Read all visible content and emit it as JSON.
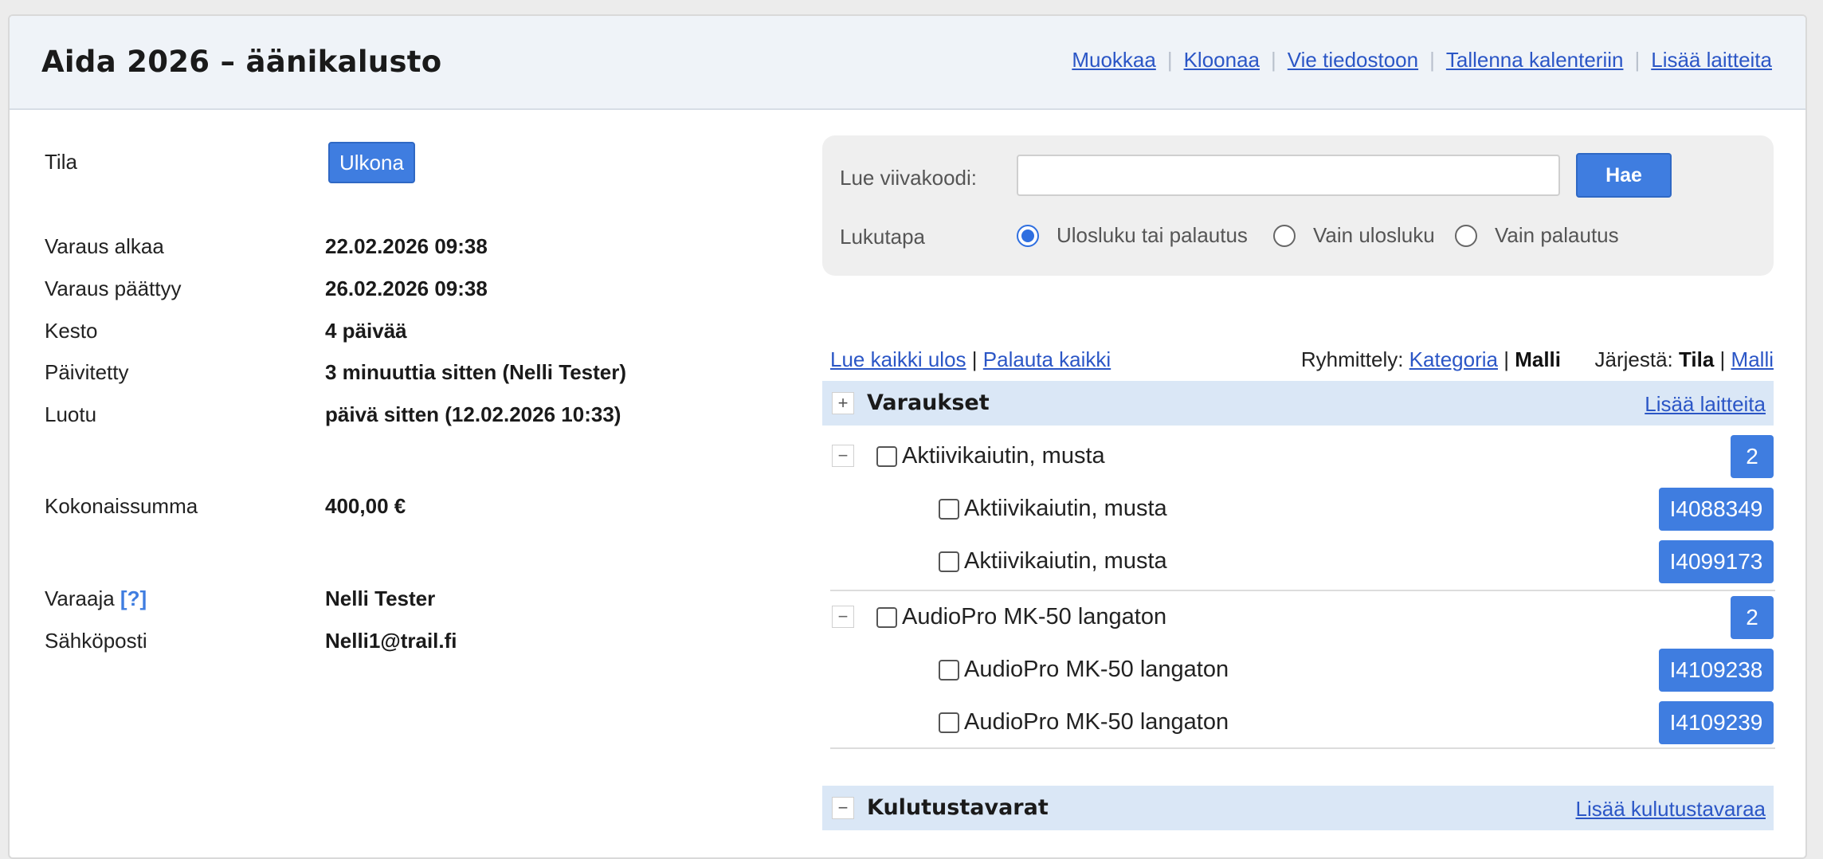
{
  "header": {
    "title": "Aida 2026 – äänikalusto",
    "links": [
      "Muokkaa",
      "Kloonaa",
      "Vie tiedostoon",
      "Tallenna kalenteriin",
      "Lisää laitteita"
    ]
  },
  "info": {
    "status_label": "Tila",
    "status_value": "Ulkona",
    "start_label": "Varaus alkaa",
    "start_value": "22.02.2026 09:38",
    "end_label": "Varaus päättyy",
    "end_value": "26.02.2026 09:38",
    "duration_label": "Kesto",
    "duration_value": "4 päivää",
    "updated_label": "Päivitetty",
    "updated_value": "3 minuuttia sitten (Nelli Tester)",
    "created_label": "Luotu",
    "created_value": "päivä sitten (12.02.2026 10:33)",
    "total_label": "Kokonaissumma",
    "total_value": "400,00 €",
    "booker_label": "Varaaja",
    "booker_help": "[?]",
    "booker_value": "Nelli Tester",
    "email_label": "Sähköposti",
    "email_value": "Nelli1@trail.fi"
  },
  "barcode": {
    "label": "Lue viivakoodi:",
    "input_value": "",
    "button": "Hae",
    "mode_label": "Lukutapa",
    "modes": [
      "Ulosluku tai palautus",
      "Vain ulosluku",
      "Vain palautus"
    ],
    "selected_mode": "Ulosluku tai palautus"
  },
  "toolbar": {
    "checkout_all": "Lue kaikki ulos",
    "return_all": "Palauta kaikki",
    "grouping_label": "Ryhmittely:",
    "grouping_category": "Kategoria",
    "grouping_model": "Malli",
    "sort_label": "Järjestä:",
    "sort_status": "Tila",
    "sort_model": "Malli",
    "separator": "|"
  },
  "reservations": {
    "title": "Varaukset",
    "toggle": "+",
    "add_link": "Lisää laitteita",
    "groups": [
      {
        "toggle": "−",
        "name": "Aktiivikaiutin, musta",
        "count": "2",
        "items": [
          {
            "name": "Aktiivikaiutin, musta",
            "id": "I4088349"
          },
          {
            "name": "Aktiivikaiutin, musta",
            "id": "I4099173"
          }
        ]
      },
      {
        "toggle": "−",
        "name": "AudioPro MK-50 langaton",
        "count": "2",
        "items": [
          {
            "name": "AudioPro MK-50 langaton",
            "id": "I4109238"
          },
          {
            "name": "AudioPro MK-50 langaton",
            "id": "I4109239"
          }
        ]
      }
    ]
  },
  "consumables": {
    "title": "Kulutustavarat",
    "toggle": "−",
    "add_link": "Lisää kulutustavaraa"
  },
  "colors": {
    "accent": "#3f7de0",
    "link": "#2b56c6",
    "header_bg": "#eff3f8",
    "section_bg": "#dae7f6"
  }
}
